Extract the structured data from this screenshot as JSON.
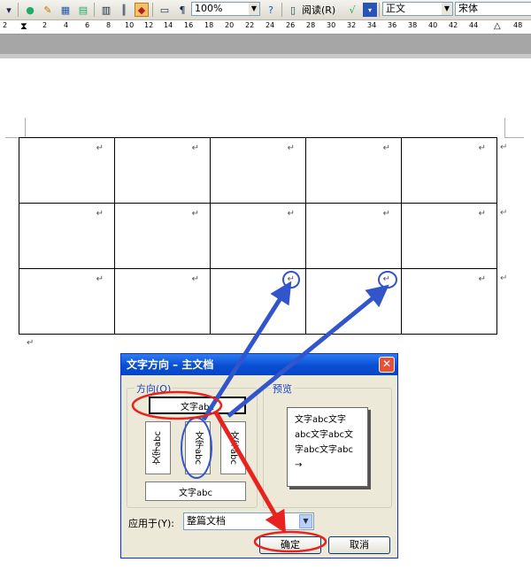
{
  "toolbar": {
    "zoom": "100%",
    "read_label": "阅读",
    "read_shortcut": "(R)",
    "style": "正文",
    "font": "宋体"
  },
  "ruler": {
    "labels": [
      "2",
      "2",
      "4",
      "6",
      "8",
      "10",
      "12",
      "14",
      "16",
      "18",
      "20",
      "22",
      "24",
      "26",
      "28",
      "30",
      "32",
      "34",
      "36",
      "38",
      "40",
      "42",
      "44",
      "48"
    ]
  },
  "document": {
    "cell_mark": "↵",
    "paragraph_mark": "↵"
  },
  "dialog": {
    "title": "文字方向 – 主文档",
    "close_glyph": "✕",
    "direction_label": "方向(O)",
    "preview_label": "预览",
    "options": {
      "horizontal": "文字abc",
      "vertical_left": "文字abc",
      "vertical_middle": "文字abc",
      "vertical_right": "文字abc",
      "horizontal_flipped": "文字abc"
    },
    "preview_lines": [
      "文字abc文字",
      "abc文字abc文",
      "字abc文字abc",
      "→"
    ],
    "apply_label": "应用于(Y):",
    "apply_value": "整篇文档",
    "ok_label": "确定",
    "cancel_label": "取消"
  },
  "annotations": {
    "highlight_color": "#e8231f",
    "pointer_color": "#3355cc"
  }
}
